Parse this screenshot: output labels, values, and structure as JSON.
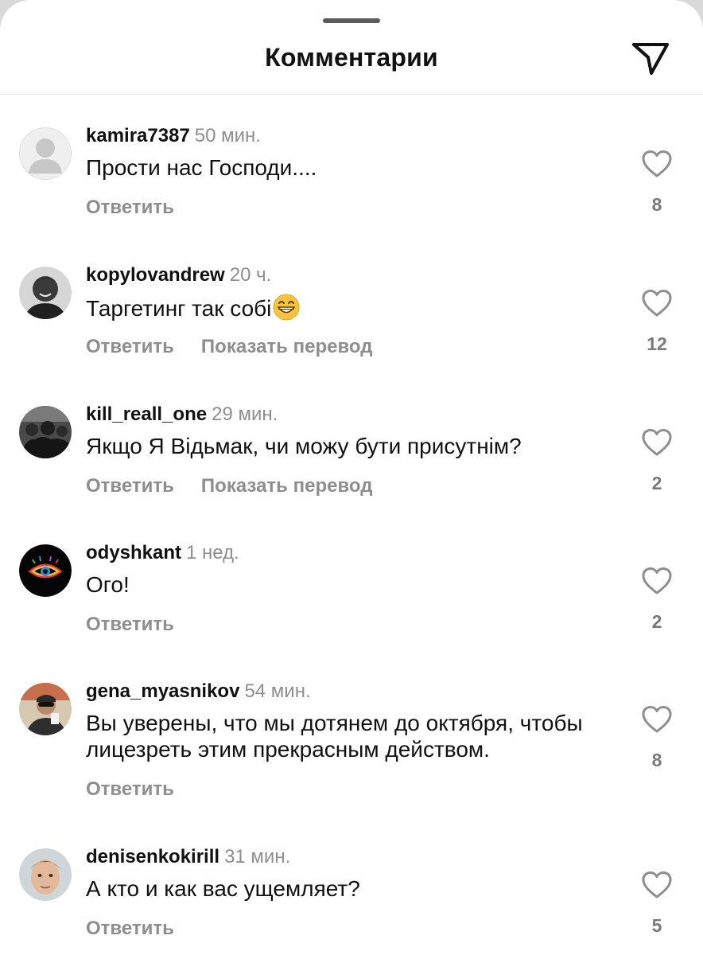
{
  "header": {
    "title": "Комментарии",
    "share_icon": "paper-plane-icon"
  },
  "labels": {
    "reply": "Ответить",
    "translate": "Показать перевод"
  },
  "comments": [
    {
      "username": "kamira7387",
      "time": "50 мин.",
      "text": "Прости нас Господи....",
      "likes": "8",
      "avatar": "default-avatar-icon"
    },
    {
      "username": "kopylovandrew",
      "time": "20 ч.",
      "text": "Таргетинг так собі",
      "emoji": "grinning-face-icon",
      "likes": "12",
      "avatar": "photo-avatar"
    },
    {
      "username": "kill_reall_one",
      "time": "29 мин.",
      "text": "Якщо Я Відьмак, чи можу бути присутнім?",
      "likes": "2",
      "avatar": "photo-avatar"
    },
    {
      "username": "odyshkant",
      "time": "1 нед.",
      "text": "Ого!",
      "likes": "2",
      "avatar": "rainbow-eye-icon"
    },
    {
      "username": "gena_myasnikov",
      "time": "54 мин.",
      "text": "Вы уверены, что мы дотянем до октября, чтобы лицезреть этим прекрасным действом.",
      "likes": "8",
      "avatar": "photo-avatar"
    },
    {
      "username": "denisenkokirill",
      "time": "31 мин.",
      "text": "А кто и как вас ущемляет?",
      "likes": "5",
      "avatar": "photo-avatar"
    }
  ],
  "colors": {
    "text": "#111111",
    "secondary": "#8e8e8e",
    "divider": "#ececec"
  }
}
